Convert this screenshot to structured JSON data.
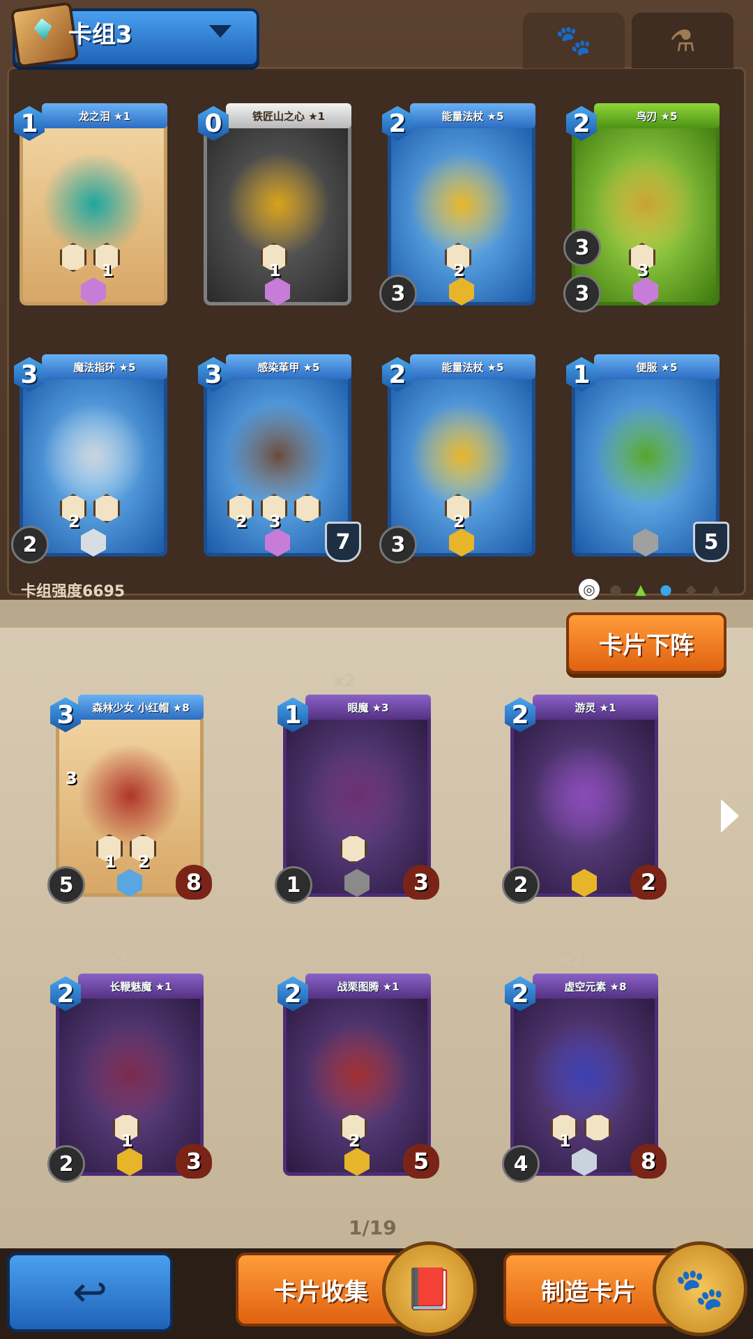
{
  "deck": {
    "name": "卡组3",
    "strength_label": "卡组强度6695",
    "tabs": [
      {
        "icon": "paw-icon"
      },
      {
        "icon": "potion-icon"
      }
    ],
    "cards": [
      {
        "cost": "1",
        "name": "龙之泪 ★1",
        "style": "tan",
        "art_color": "#1fa6a0",
        "stats": [
          "",
          "1"
        ],
        "rarity_color": "#c77dd7"
      },
      {
        "cost": "0",
        "name": "铁匠山之心 ★1",
        "style": "silver",
        "art_color": "#d8a21a",
        "stats": [
          "1"
        ],
        "rarity_color": "#c77dd7"
      },
      {
        "cost": "2",
        "name": "能量法杖 ★5",
        "style": "blue",
        "art_color": "#e7b52a",
        "stats": [
          "2"
        ],
        "left_circle": "3",
        "rarity_color": "#e7b52a"
      },
      {
        "cost": "2",
        "name": "鸟刃 ★5",
        "style": "green",
        "art_color": "#c9a032",
        "stats": [
          "3"
        ],
        "left_circle": "3",
        "left_circle2": "3",
        "rarity_color": "#c77dd7"
      },
      {
        "cost": "3",
        "name": "魔法指环 ★5",
        "style": "blue",
        "art_color": "#c9d3dd",
        "stats": [
          "2",
          ""
        ],
        "left_circle": "2",
        "rarity_color": "#d8dde3"
      },
      {
        "cost": "3",
        "name": "感染革甲 ★5",
        "style": "blue",
        "art_color": "#6b4a3a",
        "stats": [
          "2",
          "3",
          ""
        ],
        "right_shield": "7",
        "rarity_color": "#c77dd7"
      },
      {
        "cost": "2",
        "name": "能量法杖 ★5",
        "style": "blue",
        "art_color": "#e7b52a",
        "stats": [
          "2"
        ],
        "left_circle": "3",
        "rarity_color": "#e7b52a"
      },
      {
        "cost": "1",
        "name": "便服 ★5",
        "style": "blue",
        "art_color": "#56a52a",
        "stats": [],
        "right_shield": "5",
        "rarity_color": "#a0a0a0"
      }
    ]
  },
  "actions": {
    "remove_card": "卡片下阵"
  },
  "collection": {
    "cards": [
      {
        "cost": "3",
        "name": "森林少女 小红帽 ★8",
        "style": "tan",
        "art_color": "#b0352a",
        "stats": [
          "1",
          "2"
        ],
        "left_circle": "5",
        "heart": "8",
        "side_stat": "3",
        "rarity_color": "#5aa6e0"
      },
      {
        "cost": "1",
        "name": "眼魔 ★3",
        "style": "purple",
        "art_color": "#6a2f6e",
        "stats": [
          ""
        ],
        "left_circle": "1",
        "heart": "3",
        "count": "x2",
        "rarity_color": "#8a8a8a"
      },
      {
        "cost": "2",
        "name": "游灵 ★1",
        "style": "purple",
        "art_color": "#8a4ab8",
        "stats": [],
        "left_circle": "2",
        "heart": "2",
        "rarity_color": "#e7b52a"
      },
      {
        "cost": "2",
        "name": "长鞭魅魔 ★1",
        "style": "purple",
        "art_color": "#7a2a4a",
        "stats": [
          "1"
        ],
        "left_circle": "2",
        "heart": "3",
        "count": "x2",
        "rarity_color": "#e7b52a"
      },
      {
        "cost": "2",
        "name": "战栗图腾 ★1",
        "style": "purple",
        "art_color": "#a02e2e",
        "stats": [
          "2"
        ],
        "heart": "5",
        "rarity_color": "#e7b52a"
      },
      {
        "cost": "2",
        "name": "虚空元素 ★8",
        "style": "purple",
        "art_color": "#3b3fb0",
        "stats": [
          "1",
          ""
        ],
        "left_circle": "4",
        "heart": "8",
        "count": "x2",
        "rarity_color": "#c9d3dd"
      }
    ],
    "page": "1/19"
  },
  "bottom_nav": {
    "back_icon": "back-arrow-icon",
    "collection_label": "卡片收集",
    "craft_label": "制造卡片"
  }
}
